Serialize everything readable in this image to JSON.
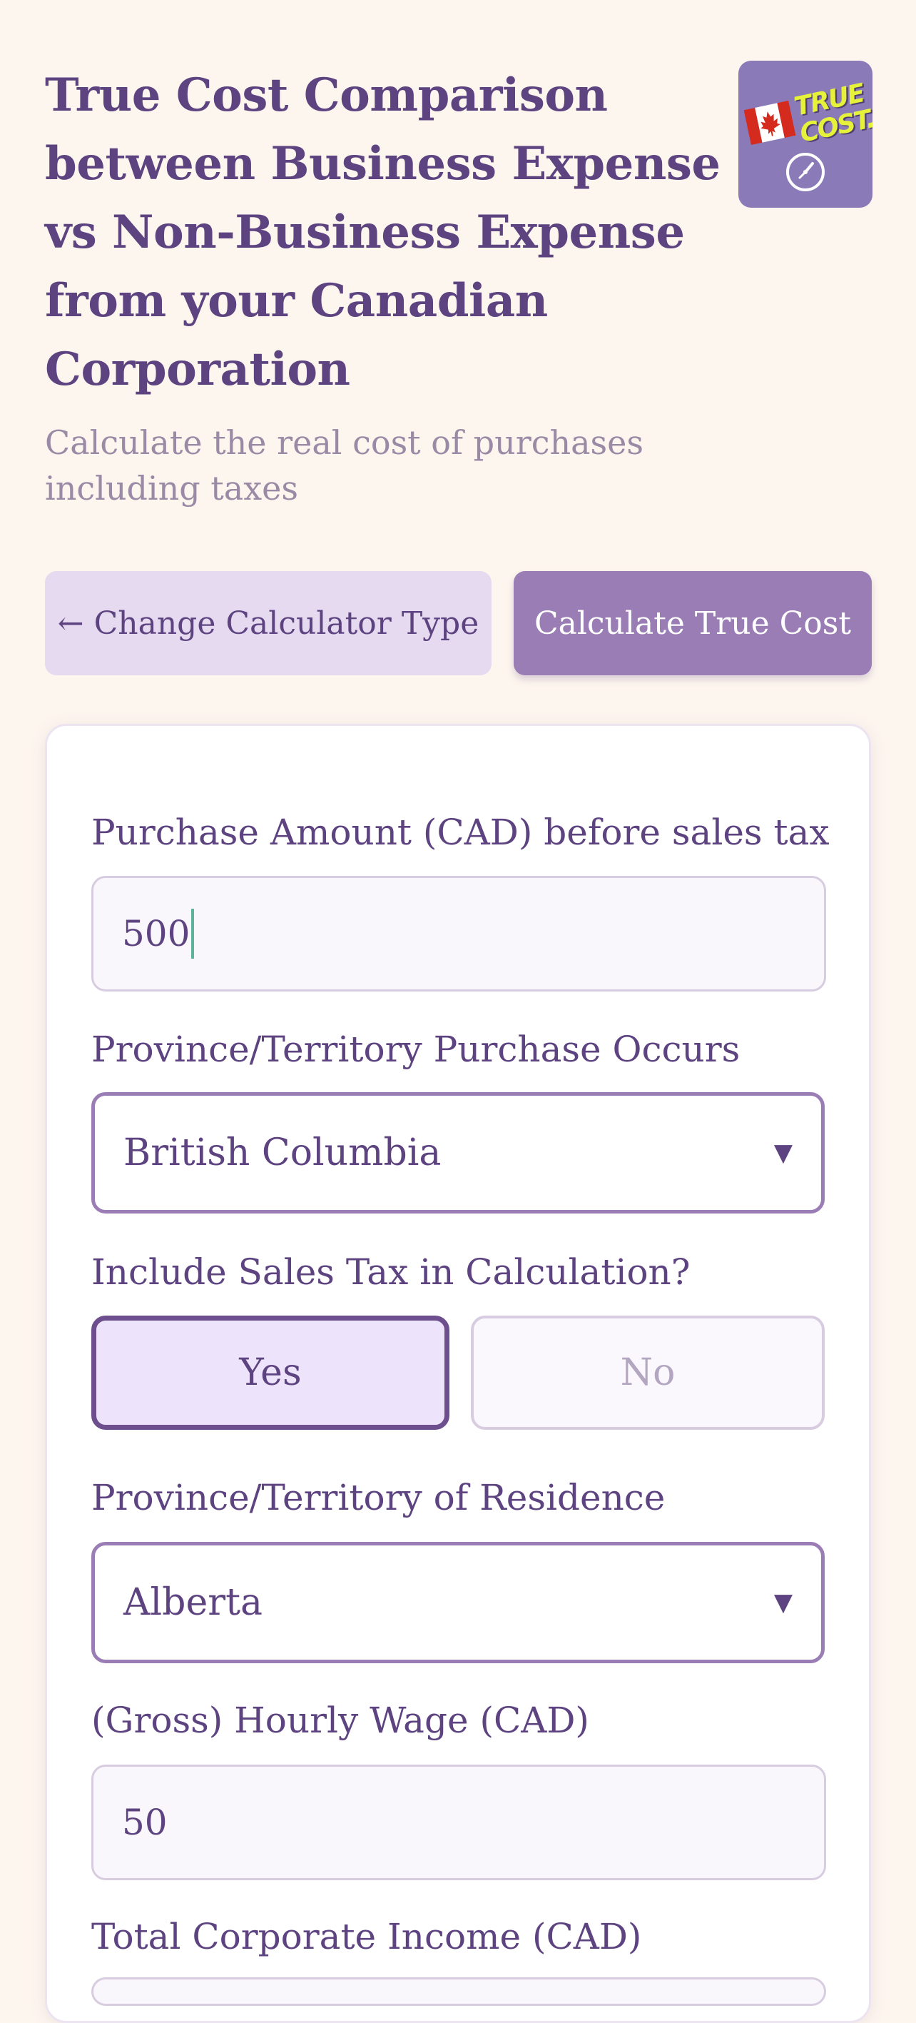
{
  "header": {
    "title": "True Cost Comparison between Business Expense vs Non-Business Expense from your Canadian Corporation",
    "subtitle": "Calculate the real cost of purchases including taxes",
    "logo_text": "TRUE COST...",
    "logo_icons": [
      "canada-flag-icon",
      "clock-icon"
    ]
  },
  "actions": {
    "change_label": "← Change Calculator Type",
    "calculate_label": "Calculate True Cost"
  },
  "form": {
    "purchase_amount": {
      "label": "Purchase Amount (CAD) before sales tax",
      "value": "500"
    },
    "purchase_province": {
      "label": "Province/Territory Purchase Occurs",
      "selected": "British Columbia",
      "arrow": "▼"
    },
    "include_sales_tax": {
      "label": "Include Sales Tax in Calculation?",
      "yes_label": "Yes",
      "no_label": "No",
      "selected": "Yes"
    },
    "residence_province": {
      "label": "Province/Territory of Residence",
      "selected": "Alberta",
      "arrow": "▼"
    },
    "hourly_wage": {
      "label": "(Gross) Hourly Wage (CAD)",
      "value": "50"
    },
    "corporate_income": {
      "label": "Total Corporate Income (CAD)"
    }
  },
  "colors": {
    "background": "#fdf6ee",
    "primary": "#9a7db5",
    "text": "#5d4380",
    "secondary_button": "#e6daf0",
    "selected_toggle": "#ede4fb",
    "logo_bg": "#8a7bb8",
    "logo_text": "#e6f23a",
    "caret": "#5fb39c"
  }
}
